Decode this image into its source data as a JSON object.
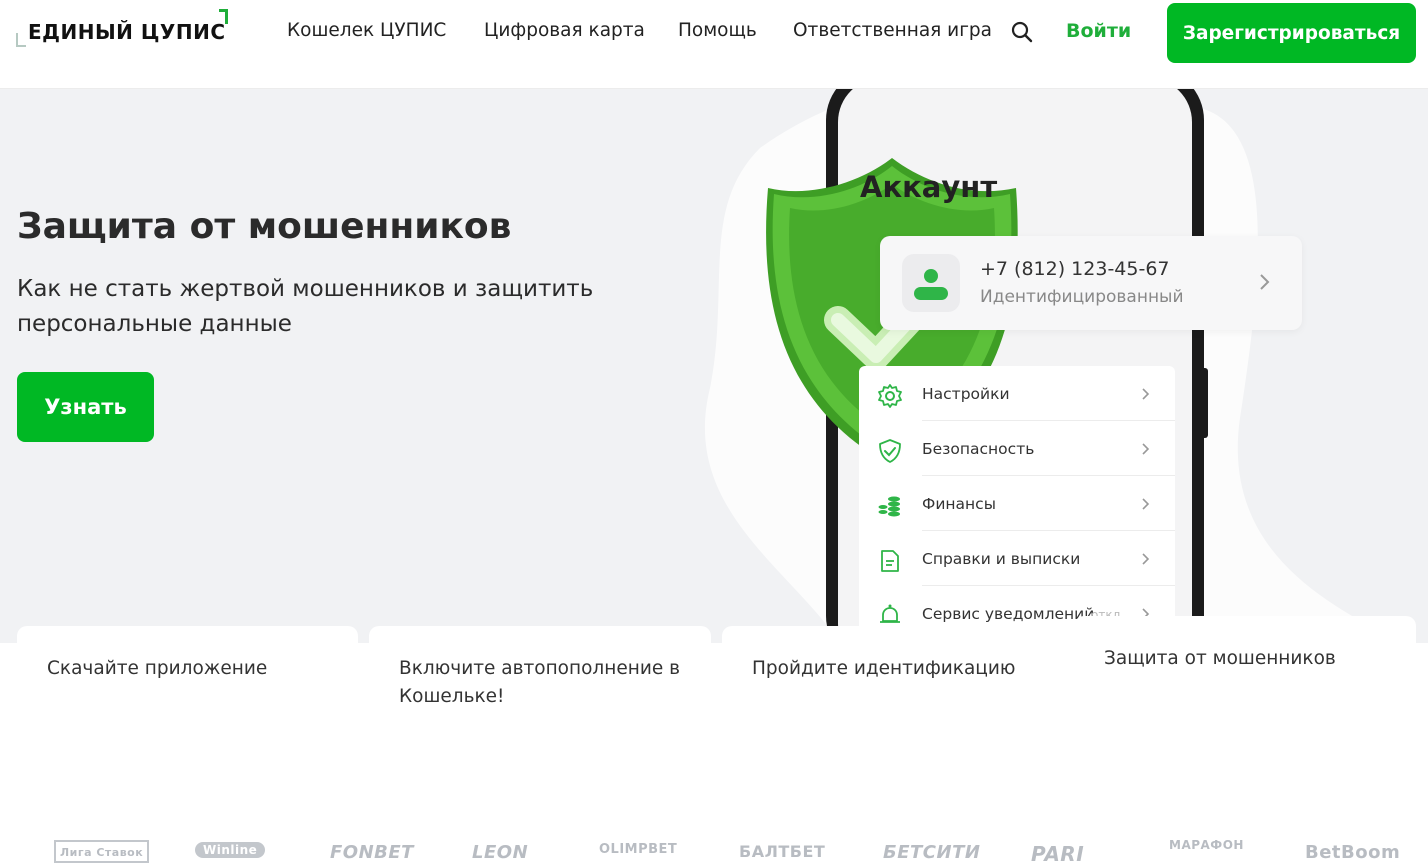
{
  "header": {
    "logo_text": "ЕДИНЫЙ ЦУПИС",
    "nav": [
      "Кошелек ЦУПИС",
      "Цифровая карта",
      "Помощь",
      "Ответственная игра"
    ],
    "search_icon": "search-icon",
    "login_label": "Войти",
    "register_label": "Зарегистрироваться"
  },
  "hero": {
    "title": "Защита от мошенников",
    "subtitle": "Как не стать жертвой мошенников и защитить персональные данные",
    "button_label": "Узнать"
  },
  "phone": {
    "account_title": "Аккаунт",
    "phone_number": "+7 (812) 123-45-67",
    "status": "Идентифицированный",
    "menu": [
      {
        "label": "Настройки",
        "icon": "gear-icon"
      },
      {
        "label": "Безопасность",
        "icon": "shield-check-icon"
      },
      {
        "label": "Финансы",
        "icon": "coins-icon"
      },
      {
        "label": "Справки и выписки",
        "icon": "document-icon"
      },
      {
        "label": "Сервис уведомлений",
        "icon": "bell-icon",
        "extra": "откл."
      }
    ]
  },
  "cards": [
    {
      "text": "Скачайте приложение"
    },
    {
      "text": "Включите автопополнение в Кошельке!"
    },
    {
      "text": "Пройдите идентификацию"
    },
    {
      "text": "Защита от мошенников"
    }
  ],
  "partners": [
    "Лига Ставок",
    "Winline",
    "FONBET",
    "LEON",
    "OLIMPBET",
    "БАЛТБЕТ",
    "БЕТСИТИ",
    "PARI",
    "МАРАФОН",
    "BetBoom"
  ],
  "colors": {
    "brand_green": "#00b824",
    "hero_bg": "#f1f2f4",
    "text_dark": "#2b2b2b"
  }
}
